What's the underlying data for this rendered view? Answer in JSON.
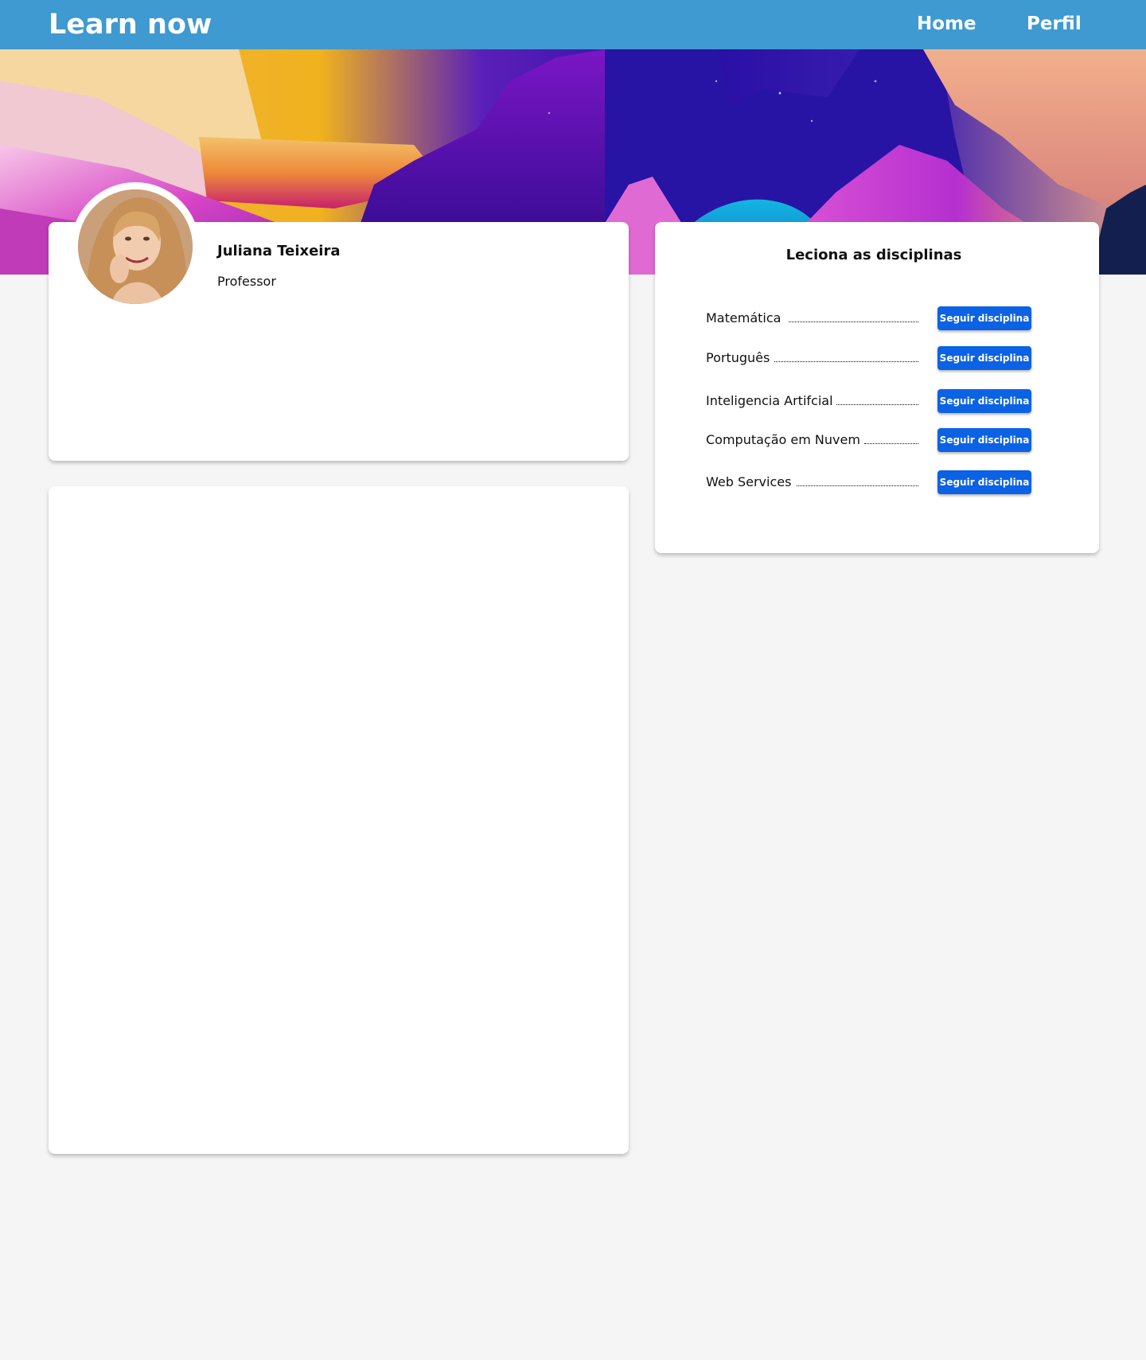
{
  "app": {
    "brand": "Learn now"
  },
  "nav": {
    "items": [
      {
        "label": "Home"
      },
      {
        "label": "Perfil"
      }
    ]
  },
  "profile": {
    "name": "Juliana Teixeira",
    "role": "Professor"
  },
  "disciplines": {
    "title": "Leciona as disciplinas",
    "items": [
      {
        "name": "Matemática",
        "button_label": "Seguir disciplina"
      },
      {
        "name": "Português",
        "button_label": "Seguir disciplina"
      },
      {
        "name": "Inteligencia Artifcial",
        "button_label": "Seguir disciplina"
      },
      {
        "name": "Computação em Nuvem",
        "button_label": "Seguir disciplina"
      },
      {
        "name": "Web Services",
        "button_label": "Seguir disciplina"
      }
    ]
  },
  "colors": {
    "topbar": "#3e9ad0",
    "page_background": "#f5f5f5",
    "button": "#0b62e4",
    "card": "#ffffff"
  }
}
